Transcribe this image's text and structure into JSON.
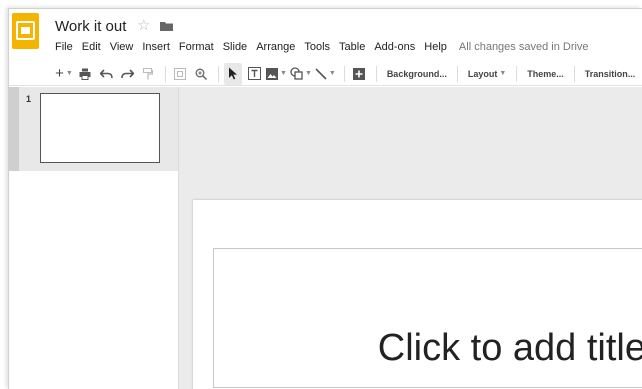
{
  "app": {
    "doc_title": "Work it out",
    "brand_color": "#f4b400"
  },
  "menu": {
    "items": [
      "File",
      "Edit",
      "View",
      "Insert",
      "Format",
      "Slide",
      "Arrange",
      "Tools",
      "Table",
      "Add-ons",
      "Help"
    ],
    "save_status": "All changes saved in Drive"
  },
  "toolbar": {
    "icons": [
      "new-slide-icon",
      "print-icon",
      "undo-icon",
      "redo-icon",
      "paint-format-icon",
      "zoom-fit-icon",
      "zoom-icon",
      "select-icon",
      "text-box-icon",
      "image-icon",
      "shape-icon",
      "line-icon",
      "comment-add-icon"
    ],
    "background_label": "Background...",
    "layout_label": "Layout",
    "theme_label": "Theme...",
    "transition_label": "Transition..."
  },
  "filmstrip": {
    "slides": [
      {
        "number": "1"
      }
    ]
  },
  "canvas": {
    "title_placeholder": "Click to add title"
  }
}
